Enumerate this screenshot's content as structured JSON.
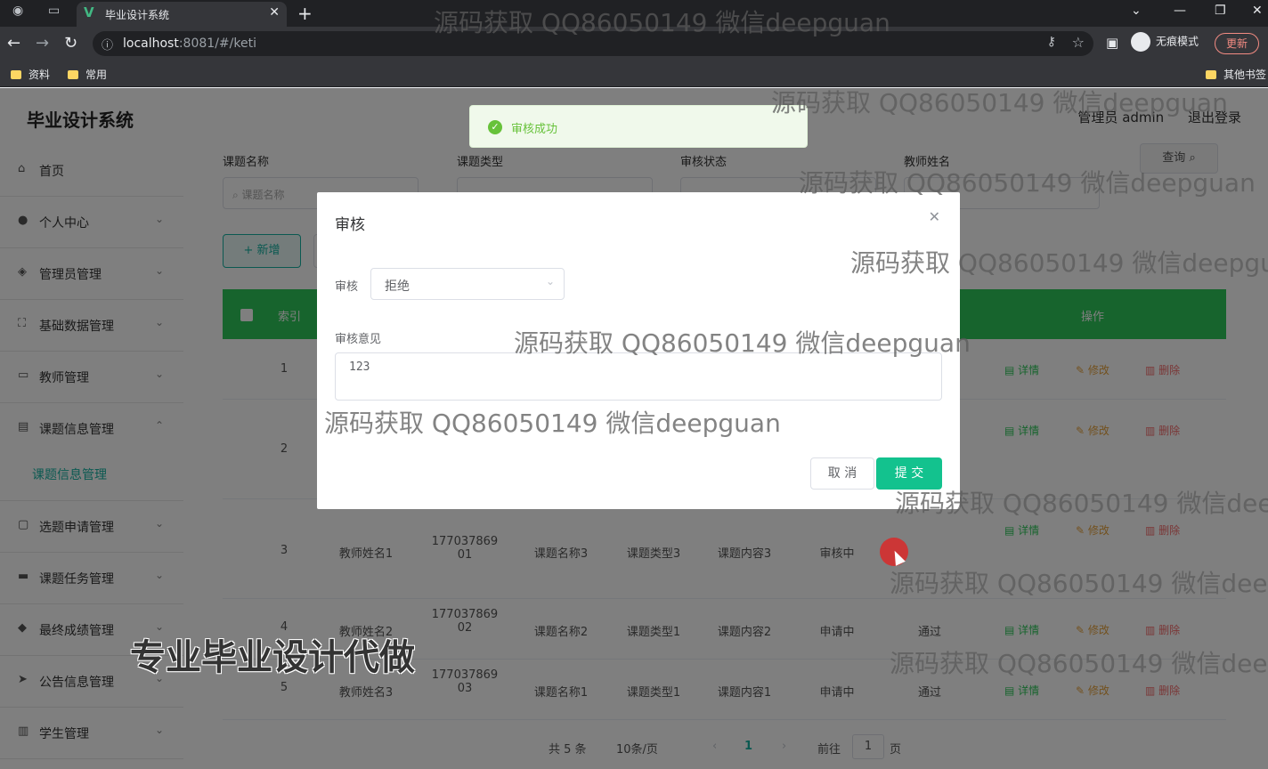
{
  "browser": {
    "tab_title": "毕业设计系统",
    "url_host": "localhost",
    "url_rest": ":8081/#/keti",
    "incognito_label": "无痕模式",
    "update_label": "更新",
    "bookmarks": [
      "资料",
      "常用"
    ],
    "other_bookmarks": "其他书签"
  },
  "app": {
    "brand": "毕业设计系统",
    "user_label": "管理员 admin",
    "logout_label": "退出登录"
  },
  "sidebar": {
    "items": [
      {
        "label": "首页",
        "icon": "home-icon"
      },
      {
        "label": "个人中心",
        "icon": "user-icon"
      },
      {
        "label": "管理员管理",
        "icon": "shield-icon"
      },
      {
        "label": "基础数据管理",
        "icon": "data-icon"
      },
      {
        "label": "教师管理",
        "icon": "teacher-icon"
      },
      {
        "label": "课题信息管理",
        "icon": "topic-icon"
      },
      {
        "label": "选题申请管理",
        "icon": "apply-icon"
      },
      {
        "label": "课题任务管理",
        "icon": "task-icon"
      },
      {
        "label": "最终成绩管理",
        "icon": "score-icon"
      },
      {
        "label": "公告信息管理",
        "icon": "notice-icon"
      },
      {
        "label": "学生管理",
        "icon": "student-icon"
      }
    ],
    "active_sub": "课题信息管理"
  },
  "filters": {
    "labels": [
      "课题名称",
      "课题类型",
      "审核状态",
      "教师姓名"
    ],
    "topic_placeholder": "课题名称",
    "query_label": "查询"
  },
  "actions": {
    "add_label": "新增"
  },
  "table": {
    "header_index": "索引",
    "header_ops": "操作",
    "ops": {
      "detail": "详情",
      "edit": "修改",
      "delete": "删除"
    },
    "rows": [
      {
        "index": "1"
      },
      {
        "index": "2"
      },
      {
        "index": "3",
        "teacher": "教师姓名1",
        "phone_a": "177037869",
        "phone_b": "01",
        "name": "课题名称3",
        "type": "课题类型3",
        "content": "课题内容3",
        "status": "审核中",
        "result": ""
      },
      {
        "index": "4",
        "teacher": "教师姓名2",
        "phone_a": "177037869",
        "phone_b": "02",
        "name": "课题名称2",
        "type": "课题类型1",
        "content": "课题内容2",
        "status": "申请中",
        "result": "通过"
      },
      {
        "index": "5",
        "teacher": "教师姓名3",
        "phone_a": "177037869",
        "phone_b": "03",
        "name": "课题名称1",
        "type": "课题类型1",
        "content": "课题内容1",
        "status": "申请中",
        "result": "通过"
      }
    ]
  },
  "pagination": {
    "total": "共 5 条",
    "page_size": "10条/页",
    "current_page": "1",
    "goto_label": "前往",
    "goto_value": "1",
    "page_suffix": "页"
  },
  "toast": {
    "message": "审核成功"
  },
  "dialog": {
    "title": "审核",
    "review_label": "审核",
    "review_value": "拒绝",
    "opinion_label": "审核意见",
    "opinion_value": "123",
    "cancel_label": "取 消",
    "submit_label": "提 交"
  },
  "watermark": "源码获取 QQ86050149 微信deepguan",
  "promo": "专业毕业设计代做"
}
